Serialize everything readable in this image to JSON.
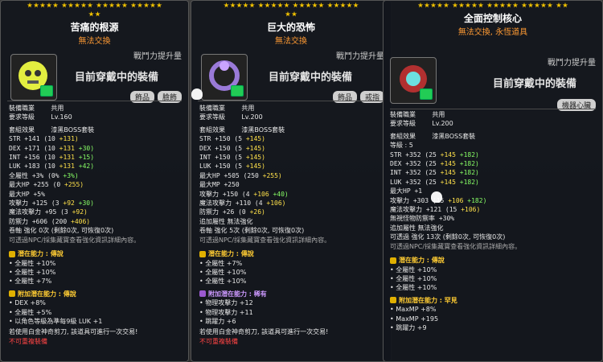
{
  "panels": [
    {
      "stars": [
        5,
        5,
        5,
        5,
        2
      ],
      "name": "苦痛的根源",
      "trade": "無法交換",
      "upgrade": "戰鬥力提升量",
      "wearing": "目前穿戴中的裝備",
      "tags": [
        "飾品",
        "臉飾"
      ],
      "job_label": "裝備職業",
      "job_value": "共用",
      "lvl_label": "要求等級",
      "lvl_value": "Lv.160",
      "set_label": "套組效果",
      "set_value": "漆黑BOSS套裝",
      "stats": [
        {
          "k": "STR",
          "v": "+141",
          "a": "(10",
          "b": "+131)",
          "c": ""
        },
        {
          "k": "DEX",
          "v": "+171",
          "a": "(10",
          "b": "+131",
          "c": "+30)"
        },
        {
          "k": "INT",
          "v": "+156",
          "a": "(10",
          "b": "+131",
          "c": "+15)"
        },
        {
          "k": "LUK",
          "v": "+183",
          "a": "(10",
          "b": "+131",
          "c": "+42)"
        },
        {
          "k": "全屬性",
          "v": "+3%",
          "a": "(0%",
          "b": "",
          "c": "+3%)"
        },
        {
          "k": "最大HP",
          "v": "+255",
          "a": "(0",
          "b": "+255)",
          "c": ""
        },
        {
          "k": "最大HP",
          "v": "+5%",
          "a": "",
          "b": "",
          "c": ""
        },
        {
          "k": "攻擊力",
          "v": "+125",
          "a": "(3",
          "b": "+92",
          "c": "+30)"
        },
        {
          "k": "魔法攻擊力",
          "v": "+95",
          "a": "(3",
          "b": "+92)",
          "c": ""
        },
        {
          "k": "防禦力",
          "v": "+606",
          "a": "(200",
          "b": "+406)",
          "c": ""
        }
      ],
      "scroll": "卷軸 強化 0次 (剩餘0次, 可恢復0次)",
      "hint": "可透過NPC/採集藏寶查看強化資訊詳細內容。",
      "potential_title": "潛在能力 : 傳說",
      "potential": [
        "全屬性 +10%",
        "全屬性 +10%",
        "全屬性 +7%"
      ],
      "add_title": "附加潛在能力 : 傳說",
      "add": [
        "DEX +8%",
        "全屬性 +5%",
        "以角色等級為準每9級 LUK +1"
      ],
      "footer": "若使用白金神奇剪刀, 該道具可進行一次交易!",
      "footer2": "不可重複裝備"
    },
    {
      "stars": [
        5,
        5,
        5,
        5,
        2
      ],
      "name": "巨大的恐怖",
      "trade": "無法交換",
      "upgrade": "戰鬥力提升量",
      "wearing": "目前穿戴中的裝備",
      "tags": [
        "飾品",
        "戒指"
      ],
      "job_label": "裝備職業",
      "job_value": "共用",
      "lvl_label": "要求等級",
      "lvl_value": "Lv.200",
      "set_label": "套組效果",
      "set_value": "漆黑BOSS套裝",
      "stats": [
        {
          "k": "STR",
          "v": "+150",
          "a": "(5",
          "b": "+145)",
          "c": ""
        },
        {
          "k": "DEX",
          "v": "+150",
          "a": "(5",
          "b": "+145)",
          "c": ""
        },
        {
          "k": "INT",
          "v": "+150",
          "a": "(5",
          "b": "+145)",
          "c": ""
        },
        {
          "k": "LUK",
          "v": "+150",
          "a": "(5",
          "b": "+145)",
          "c": ""
        },
        {
          "k": "最大HP",
          "v": "+505",
          "a": "(250",
          "b": "+255)",
          "c": ""
        },
        {
          "k": "最大MP",
          "v": "+250",
          "a": "",
          "b": "",
          "c": ""
        },
        {
          "k": "攻擊力",
          "v": "+150",
          "a": "(4",
          "b": "+106",
          "c": "+40)"
        },
        {
          "k": "魔法攻擊力",
          "v": "+110",
          "a": "(4",
          "b": "+106)",
          "c": ""
        },
        {
          "k": "防禦力",
          "v": "+26",
          "a": "(0",
          "b": "+26)",
          "c": ""
        }
      ],
      "extra": "追加屬性 無法強化",
      "scroll": "卷軸 強化 5次 (剩餘0次, 可恢復0次)",
      "hint": "可透過NPC/採集藏寶查看強化資訊詳細內容。",
      "potential_title": "潛在能力 : 傳說",
      "potential": [
        "全屬性 +7%",
        "全屬性 +10%",
        "全屬性 +10%"
      ],
      "add_title": "附加潛在能力 : 稀有",
      "add": [
        "物理攻擊力 +12",
        "物理攻擊力 +11",
        "跳躍力 +6"
      ],
      "footer": "若使用白金神奇剪刀, 該道具可進行一次交易!",
      "footer2": "不可重複裝備"
    },
    {
      "stars": [
        5,
        5,
        5,
        5,
        2
      ],
      "name": "全面控制核心",
      "trade": "無法交換, 永恆道具",
      "upgrade": "戰鬥力提升量",
      "wearing": "目前穿戴中的裝備",
      "tags": [
        "機器心臟"
      ],
      "job_label": "裝備職業",
      "job_value": "共用",
      "lvl_label": "要求等級",
      "lvl_value": "Lv.200",
      "set_label": "套組效果",
      "set_value": "漆黑BOSS套裝",
      "level": "等級 : 5",
      "stats": [
        {
          "k": "STR",
          "v": "+352",
          "a": "(25",
          "b": "+145",
          "c": "+182)"
        },
        {
          "k": "DEX",
          "v": "+352",
          "a": "(25",
          "b": "+145",
          "c": "+182)"
        },
        {
          "k": "INT",
          "v": "+352",
          "a": "(25",
          "b": "+145",
          "c": "+182)"
        },
        {
          "k": "LUK",
          "v": "+352",
          "a": "(25",
          "b": "+145",
          "c": "+182)"
        },
        {
          "k": "最大HP",
          "v": "+1",
          "a": "",
          "b": "",
          "c": ""
        },
        {
          "k": "攻擊力",
          "v": "+303",
          "a": "(15",
          "b": "+106",
          "c": "+182)"
        },
        {
          "k": "魔法攻擊力",
          "v": "+121",
          "a": "(15",
          "b": "+106)",
          "c": ""
        },
        {
          "k": "無視怪物防禦率",
          "v": "+30%",
          "a": "",
          "b": "",
          "c": ""
        }
      ],
      "extra": "追加屬性 無法強化",
      "scroll": "可透過 強化 13次 (剩餘0次, 可恢復0次)",
      "hint": "可透過NPC/採集藏寶查看強化資訊詳細內容。",
      "potential_title": "潛在能力 : 傳說",
      "potential": [
        "全屬性 +10%",
        "全屬性 +10%",
        "全屬性 +10%"
      ],
      "add_title": "附加潛在能力 : 罕見",
      "add": [
        "MaxMP +8%",
        "MaxMP +195",
        "跳躍力 +9"
      ],
      "footer": "",
      "footer2": ""
    }
  ],
  "colors": {
    "stars": "#f2c200",
    "trade": "#ff9a33",
    "legend": "#e0b000",
    "rare": "#9b59d0"
  }
}
